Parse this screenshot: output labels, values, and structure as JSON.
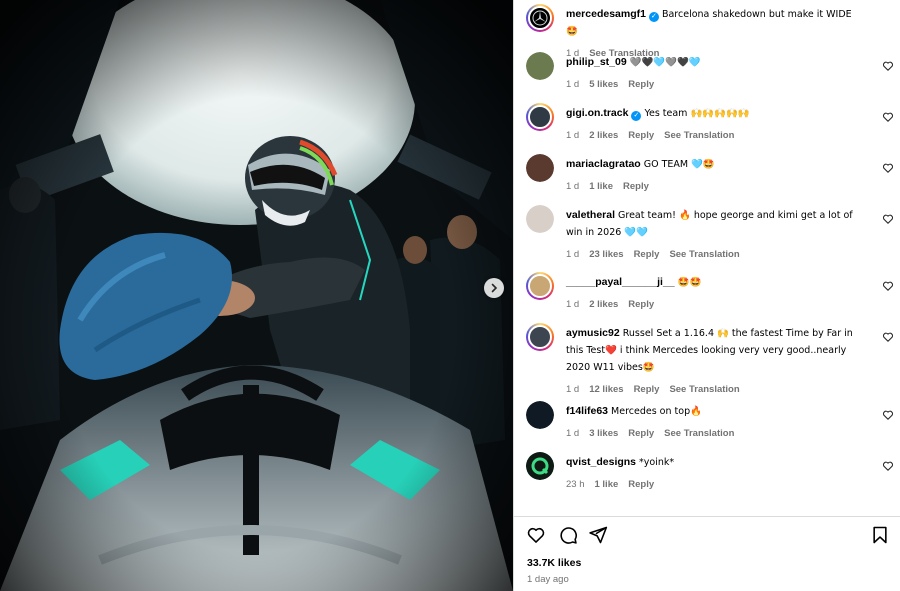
{
  "post": {
    "author": "mercedesamgf1",
    "caption": "Barcelona shakedown but make it WIDE 🤩",
    "age": "1 d",
    "see_translation": "See Translation"
  },
  "comments": [
    {
      "user": "philip_st_09",
      "text": "🩶🖤🩵🩶🖤🩵",
      "verified": false,
      "age": "1 d",
      "likes": "5 likes",
      "reply": "Reply",
      "translate": "",
      "avatar_color": "#6b7a4f"
    },
    {
      "user": "gigi.on.track",
      "text": "Yes team 🙌🙌🙌🙌🙌",
      "verified": true,
      "age": "1 d",
      "likes": "2 likes",
      "reply": "Reply",
      "translate": "See Translation",
      "avatar_color": "#2f3a44"
    },
    {
      "user": "mariaclagratao",
      "text": "GO TEAM 🩵🤩",
      "verified": false,
      "age": "1 d",
      "likes": "1 like",
      "reply": "Reply",
      "translate": "",
      "avatar_color": "#5a3a2e"
    },
    {
      "user": "valetheral",
      "text": "Great team! 🔥 hope george and kimi get a lot of win in 2026 🩵🩵",
      "verified": false,
      "age": "1 d",
      "likes": "23 likes",
      "reply": "Reply",
      "translate": "See Translation",
      "avatar_color": "#d8cfc8"
    },
    {
      "user": "_____payal______ji__",
      "text": "🤩🤩",
      "verified": false,
      "age": "1 d",
      "likes": "2 likes",
      "reply": "Reply",
      "translate": "",
      "avatar_color": "#c9a774"
    },
    {
      "user": "aymusic92",
      "text": "Russel Set a 1.16.4 🙌 the fastest Time by Far in this Test❤️ i think Mercedes looking very very good..nearly 2020 W11 vibes🤩",
      "verified": false,
      "age": "1 d",
      "likes": "12 likes",
      "reply": "Reply",
      "translate": "See Translation",
      "avatar_color": "#3d4650"
    },
    {
      "user": "f14life63",
      "text": "Mercedes on top🔥",
      "verified": false,
      "age": "1 d",
      "likes": "3 likes",
      "reply": "Reply",
      "translate": "See Translation",
      "avatar_color": "#0f1a24"
    },
    {
      "user": "qvist_designs",
      "text": "*yoink*",
      "verified": false,
      "age": "23 h",
      "likes": "1 like",
      "reply": "Reply",
      "translate": "",
      "avatar_color": "#0f7a3a"
    }
  ],
  "footer": {
    "likes": "33.7K likes",
    "time": "1 day ago"
  },
  "colors": {
    "verified": "#0095f6",
    "muted": "#737373",
    "divider": "#dbdbdb"
  },
  "icons": [
    "heart-icon",
    "comment-icon",
    "share-icon",
    "bookmark-icon",
    "chevron-right-icon",
    "verified-icon"
  ]
}
